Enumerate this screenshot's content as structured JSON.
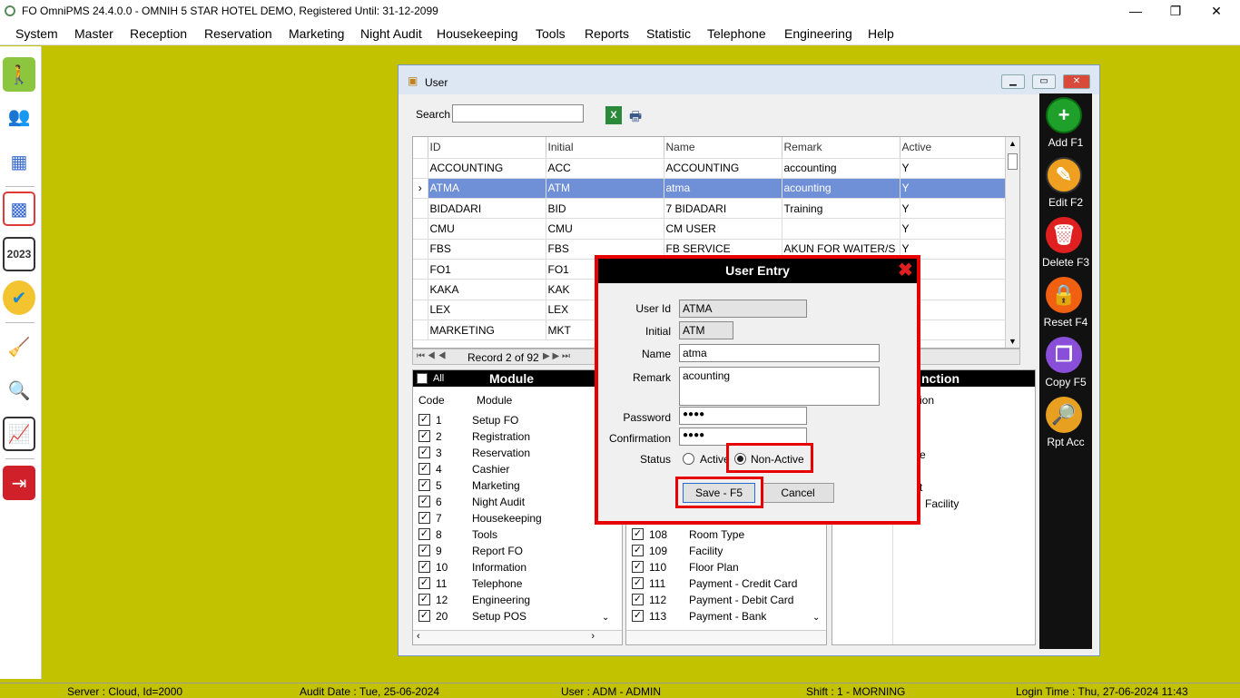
{
  "app": {
    "title": "FO OmniPMS 24.4.0.0 - OMNIH 5 STAR HOTEL DEMO, Registered Until: 31-12-2099"
  },
  "menu": [
    "System",
    "Master",
    "Reception",
    "Reservation",
    "Marketing",
    "Night Audit",
    "Housekeeping",
    "Tools",
    "Reports",
    "Statistic",
    "Telephone",
    "Engineering",
    "Help"
  ],
  "left_toolbar": [
    "walking-person-icon",
    "users-icon",
    "floor-plan-icon",
    "calendar-grid-icon",
    "calendar-2023-icon",
    "availability-badge-icon",
    "housekeeping-icon",
    "search-chart-icon",
    "statistics-chart-icon",
    "exit-icon"
  ],
  "user_window": {
    "title": "User",
    "search_label": "Search",
    "search_value": "",
    "columns": [
      "ID",
      "Initial",
      "Name",
      "Remark",
      "Active"
    ],
    "rows": [
      [
        "ACCOUNTING",
        "ACC",
        "ACCOUNTING",
        "accounting",
        "Y"
      ],
      [
        "ATMA",
        "ATM",
        "atma",
        "acounting",
        "Y"
      ],
      [
        "BIDADARI",
        "BID",
        "7 BIDADARI",
        "Training",
        "Y"
      ],
      [
        "CMU",
        "CMU",
        "CM USER",
        "",
        "Y"
      ],
      [
        "FBS",
        "FBS",
        "FB SERVICE",
        "AKUN FOR WAITER/S",
        "Y"
      ],
      [
        "FO1",
        "FO1",
        "",
        "",
        ""
      ],
      [
        "KAKA",
        "KAK",
        "",
        "",
        ""
      ],
      [
        "LEX",
        "LEX",
        "",
        "",
        ""
      ],
      [
        "MARKETING",
        "MKT",
        "",
        "",
        ""
      ]
    ],
    "record_nav": "Record 2 of 92",
    "module_panel": {
      "all_label": "All",
      "title": "Module",
      "col_code": "Code",
      "col_module": "Module",
      "items": [
        [
          "1",
          "Setup FO"
        ],
        [
          "2",
          "Registration"
        ],
        [
          "3",
          "Reservation"
        ],
        [
          "4",
          "Cashier"
        ],
        [
          "5",
          "Marketing"
        ],
        [
          "6",
          "Night Audit"
        ],
        [
          "7",
          "Housekeeping"
        ],
        [
          "8",
          "Tools"
        ],
        [
          "9",
          "Report FO"
        ],
        [
          "10",
          "Information"
        ],
        [
          "11",
          "Telephone"
        ],
        [
          "12",
          "Engineering"
        ],
        [
          "20",
          "Setup POS"
        ]
      ]
    },
    "sub_panel": {
      "items": [
        [
          "108",
          "Room Type"
        ],
        [
          "109",
          "Facility"
        ],
        [
          "110",
          "Floor Plan"
        ],
        [
          "111",
          "Payment - Credit Card"
        ],
        [
          "112",
          "Payment - Debit Card"
        ],
        [
          "113",
          "Payment - Bank"
        ]
      ]
    },
    "function_panel": {
      "title_partial": "nction",
      "col_partial": "ion",
      "row_e": "e",
      "row_t": "t",
      "row_facility": "Facility"
    }
  },
  "right_actions": [
    {
      "label": "Add F1",
      "icon": "plus-icon",
      "color": "#1ea02a"
    },
    {
      "label": "Edit F2",
      "icon": "edit-icon",
      "color": "#f0a020"
    },
    {
      "label": "Delete F3",
      "icon": "trash-icon",
      "color": "#e02020"
    },
    {
      "label": "Reset F4",
      "icon": "lock-icon",
      "color": "#f06010"
    },
    {
      "label": "Copy F5",
      "icon": "copy-icon",
      "color": "#8a4fd8"
    },
    {
      "label": "Rpt Acc",
      "icon": "report-icon",
      "color": "#e8a020"
    }
  ],
  "dialog": {
    "title": "User Entry",
    "user_id_label": "User Id",
    "user_id": "ATMA",
    "initial_label": "Initial",
    "initial": "ATM",
    "name_label": "Name",
    "name": "atma",
    "remark_label": "Remark",
    "remark": "acounting",
    "password_label": "Password",
    "password": "●●●●",
    "confirmation_label": "Confirmation",
    "confirmation": "●●●●",
    "status_label": "Status",
    "status_active": "Active",
    "status_nonactive": "Non-Active",
    "status_selected": "Non-Active",
    "save": "Save - F5",
    "cancel": "Cancel"
  },
  "status_bar": {
    "server": "Server : Cloud, Id=2000",
    "audit_date": "Audit Date : Tue, 25-06-2024",
    "user": "User : ADM - ADMIN",
    "shift": "Shift : 1 - MORNING",
    "login_time": "Login Time : Thu, 27-06-2024 11:43"
  }
}
